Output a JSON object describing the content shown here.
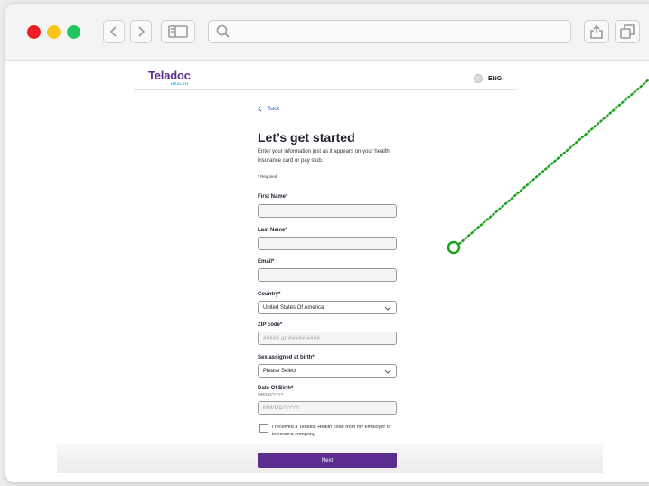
{
  "browser": {
    "icons": [
      "back-arrow-icon",
      "forward-arrow-icon",
      "sidebar-icon",
      "search-icon",
      "share-icon",
      "tabs-icon"
    ]
  },
  "header": {
    "logo": "Teladoc",
    "logo_sub": "HEALTH",
    "language": "ENG"
  },
  "form": {
    "back_label": "Back",
    "title": "Let’s get started",
    "intro": "Enter your information just as it appears on your health insurance card or pay stub.",
    "required_note": "* Required",
    "first_name": {
      "label": "First Name*",
      "value": ""
    },
    "last_name": {
      "label": "Last Name*",
      "value": ""
    },
    "email": {
      "label": "Email*",
      "value": ""
    },
    "country": {
      "label": "Country*",
      "value": "United States Of America"
    },
    "zip": {
      "label": "ZIP code*",
      "placeholder": "##### or #####-####"
    },
    "sex": {
      "label": "Sex assigned at birth*",
      "value": "Please Select"
    },
    "dob": {
      "label": "Date Of Birth*",
      "format_hint": "MM/DD/YYYY",
      "placeholder": "MM/DD/YYYY"
    },
    "code_checkbox": {
      "label": "I received a Teladoc Health code from my employer or insurance company.",
      "checked": false
    },
    "next_label": "Next"
  },
  "colors": {
    "brand_purple": "#5b2d90",
    "brand_cyan": "#00b5e2",
    "link_blue": "#2a6fd6",
    "annotation_green": "#1aa31a"
  }
}
